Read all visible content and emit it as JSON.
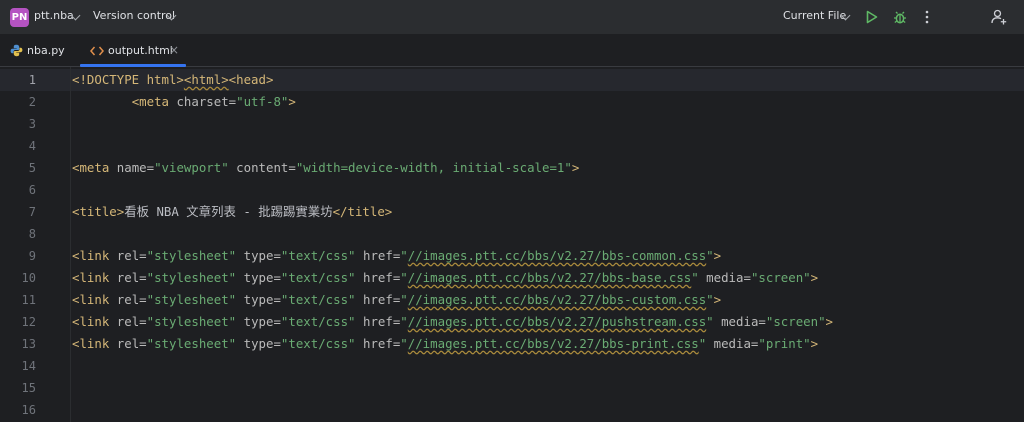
{
  "titlebar": {
    "project_badge": "PN",
    "project_name": "ptt.nba",
    "vcs_label": "Version control",
    "run_config": "Current File"
  },
  "tabs": [
    {
      "label": "nba.py",
      "icon": "python-file-icon"
    },
    {
      "label": "output.html",
      "icon": "html-file-icon",
      "close": "×"
    }
  ],
  "editor": {
    "current_line": 1,
    "line_numbers": [
      "1",
      "2",
      "3",
      "4",
      "5",
      "6",
      "7",
      "8",
      "9",
      "10",
      "11",
      "12",
      "13",
      "14",
      "15",
      "16"
    ],
    "lines": [
      {
        "doctype": "<!DOCTYPE html>",
        "html_tag": "<html>",
        "head_tag": "<head>"
      },
      {
        "indent": "        ",
        "open": "<meta",
        "attr1": " charset=",
        "val1": "\"utf-8\"",
        "close": ">"
      },
      {},
      {},
      {
        "open": "<meta",
        "attr1": " name=",
        "val1": "\"viewport\"",
        "attr2": " content=",
        "val2": "\"width=device-width, initial-scale=1\"",
        "close": ">"
      },
      {},
      {
        "open": "<title>",
        "text": "看板 NBA 文章列表 - 批踢踢實業坊",
        "close": "</title>"
      },
      {},
      {
        "open": "<link",
        "attr1": " rel=",
        "val1": "\"stylesheet\"",
        "attr2": " type=",
        "val2": "\"text/css\"",
        "attr3": " href=",
        "q1": "\"",
        "url": "//images.ptt.cc/bbs/v2.27/bbs-common.css",
        "q2": "\"",
        "close": ">"
      },
      {
        "open": "<link",
        "attr1": " rel=",
        "val1": "\"stylesheet\"",
        "attr2": " type=",
        "val2": "\"text/css\"",
        "attr3": " href=",
        "q1": "\"",
        "url": "//images.ptt.cc/bbs/v2.27/bbs-base.css",
        "q2": "\"",
        "attr4": " media=",
        "val4": "\"screen\"",
        "close": ">"
      },
      {
        "open": "<link",
        "attr1": " rel=",
        "val1": "\"stylesheet\"",
        "attr2": " type=",
        "val2": "\"text/css\"",
        "attr3": " href=",
        "q1": "\"",
        "url": "//images.ptt.cc/bbs/v2.27/bbs-custom.css",
        "q2": "\"",
        "close": ">"
      },
      {
        "open": "<link",
        "attr1": " rel=",
        "val1": "\"stylesheet\"",
        "attr2": " type=",
        "val2": "\"text/css\"",
        "attr3": " href=",
        "q1": "\"",
        "url": "//images.ptt.cc/bbs/v2.27/pushstream.css",
        "q2": "\"",
        "attr4": " media=",
        "val4": "\"screen\"",
        "close": ">"
      },
      {
        "open": "<link",
        "attr1": " rel=",
        "val1": "\"stylesheet\"",
        "attr2": " type=",
        "val2": "\"text/css\"",
        "attr3": " href=",
        "q1": "\"",
        "url": "//images.ptt.cc/bbs/v2.27/bbs-print.css",
        "q2": "\"",
        "attr4": " media=",
        "val4": "\"print\"",
        "close": ">"
      }
    ]
  },
  "colors": {
    "background": "#1e1f22",
    "toolbar": "#2b2d30",
    "tag": "#d5b778",
    "string": "#6aab73",
    "attribute": "#bababa",
    "accent": "#3574f0",
    "run_green": "#5fb865"
  }
}
